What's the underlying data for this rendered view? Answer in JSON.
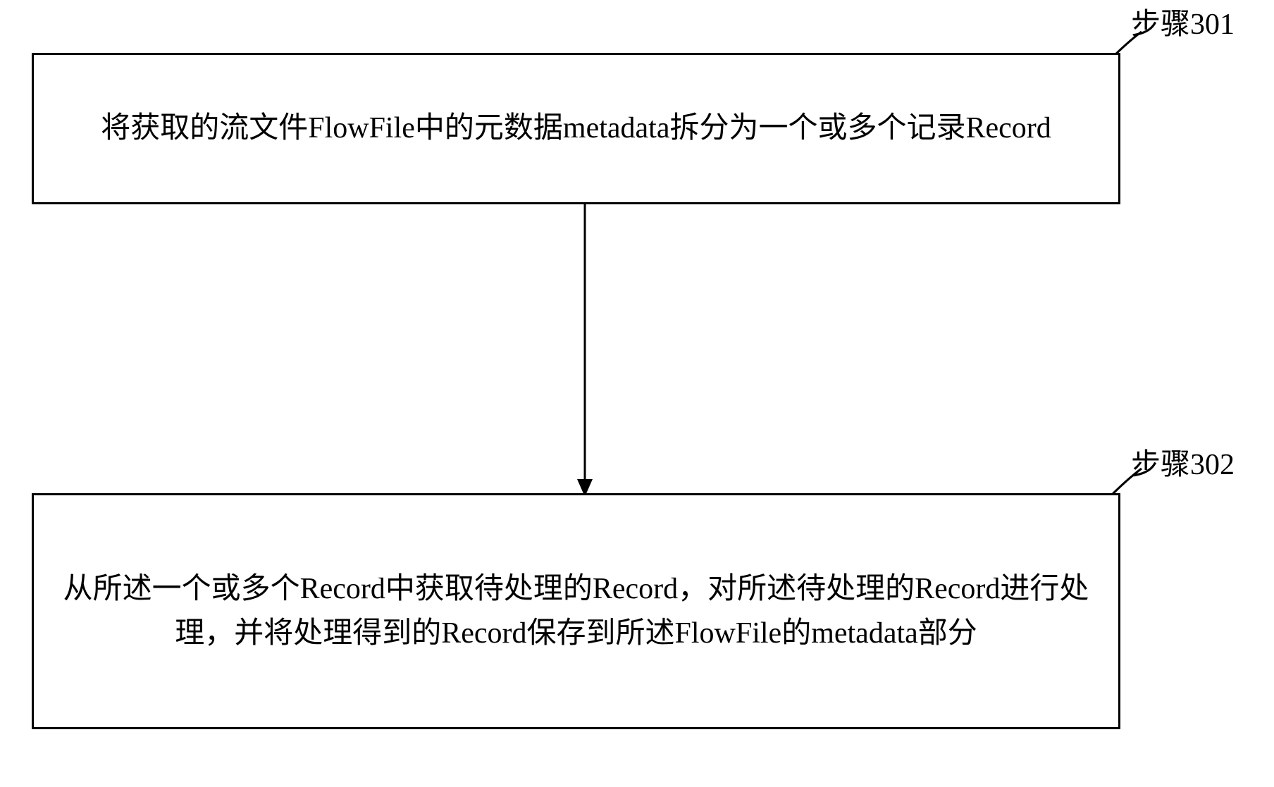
{
  "steps": [
    {
      "label": "步骤301",
      "text": "将获取的流文件FlowFile中的元数据metadata拆分为一个或多个记录Record"
    },
    {
      "label": "步骤302",
      "text": "从所述一个或多个Record中获取待处理的Record，对所述待处理的Record进行处理，并将处理得到的Record保存到所述FlowFile的metadata部分"
    }
  ]
}
